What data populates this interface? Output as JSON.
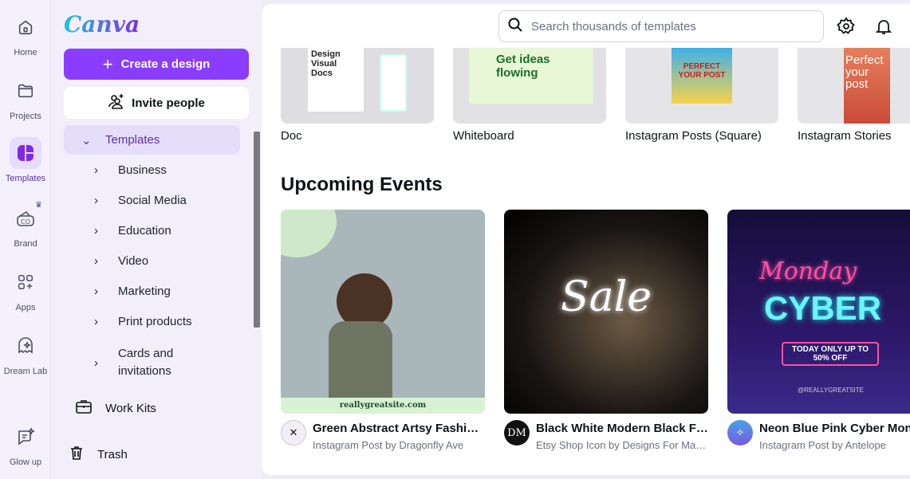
{
  "rail": [
    {
      "label": "Home",
      "icon": "home-icon"
    },
    {
      "label": "Projects",
      "icon": "folder-icon"
    },
    {
      "label": "Templates",
      "icon": "templates-icon",
      "active": true
    },
    {
      "label": "Brand",
      "icon": "brand-icon"
    },
    {
      "label": "Apps",
      "icon": "apps-icon"
    },
    {
      "label": "Dream Lab",
      "icon": "dream-lab-icon"
    },
    {
      "label": "Glow up",
      "icon": "glow-up-icon"
    }
  ],
  "panel": {
    "logo": "Canva",
    "create": "Create a design",
    "invite": "Invite people",
    "templates": "Templates",
    "subitems": [
      "Business",
      "Social Media",
      "Education",
      "Video",
      "Marketing",
      "Print products",
      "Cards and invitations"
    ],
    "work_kits": "Work Kits",
    "trash": "Trash"
  },
  "header": {
    "search_placeholder": "Search thousands of templates"
  },
  "top_types": [
    {
      "label": "Doc",
      "art": "Design Visual Docs"
    },
    {
      "label": "Whiteboard",
      "art": "Get ideas flowing"
    },
    {
      "label": "Instagram Posts (Square)",
      "art": "PERFECT YOUR POST"
    },
    {
      "label": "Instagram Stories",
      "art": "Perfect your post"
    }
  ],
  "section_title": "Upcoming Events",
  "events": [
    {
      "title": "Green Abstract Artsy Fashion ...",
      "subtitle": "Instagram Post by Dragonfly Ave",
      "art": "reallygreatsite.com"
    },
    {
      "title": "Black White Modern Black Fri...",
      "subtitle": "Etsy Shop Icon by Designs For Make...",
      "art": "Sale",
      "avatar": "DM"
    },
    {
      "title": "Neon Blue Pink Cyber Mond",
      "subtitle": "Instagram Post by Antelope",
      "art": "Monday",
      "art2": "CYBER",
      "art3": "TODAY ONLY UP TO 50% OFF",
      "art4": "@REALLYGREATSITE"
    }
  ],
  "colors": {
    "accent": "#8b3dff",
    "active_bg": "#e6ddfb"
  }
}
